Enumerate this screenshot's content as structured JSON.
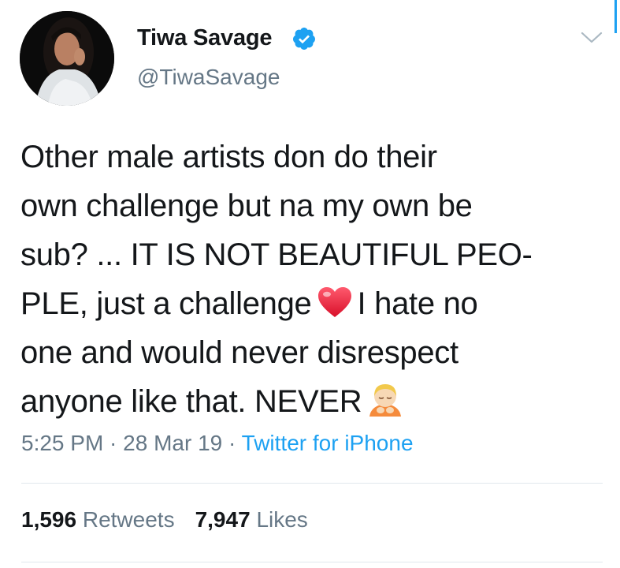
{
  "user": {
    "display_name": "Tiwa Savage",
    "handle": "@TiwaSavage",
    "verified": true
  },
  "tweet": {
    "lines": [
      "Other male artists don do their",
      "own challenge but na my own be",
      "sub? ... IT IS NOT BEAUTIFUL PEO-",
      "PLE, just a challenge",
      "I hate no",
      "one and would never disrespect",
      "anyone like that. NEVER"
    ],
    "emojis": [
      "heart-emoji",
      "person-bowing-emoji"
    ]
  },
  "meta": {
    "time": "5:25 PM",
    "separator": " · ",
    "date": "28 Mar 19",
    "source": "Twitter for iPhone"
  },
  "stats": {
    "retweets_count": "1,596",
    "retweets_label": "Retweets",
    "likes_count": "7,947",
    "likes_label": "Likes"
  },
  "colors": {
    "accent": "#1da1f2",
    "text": "#14171a",
    "secondary": "#657786",
    "divider": "#e1e8ed"
  },
  "icons": [
    "avatar-photo",
    "verified-badge-icon",
    "chevron-down-icon"
  ]
}
